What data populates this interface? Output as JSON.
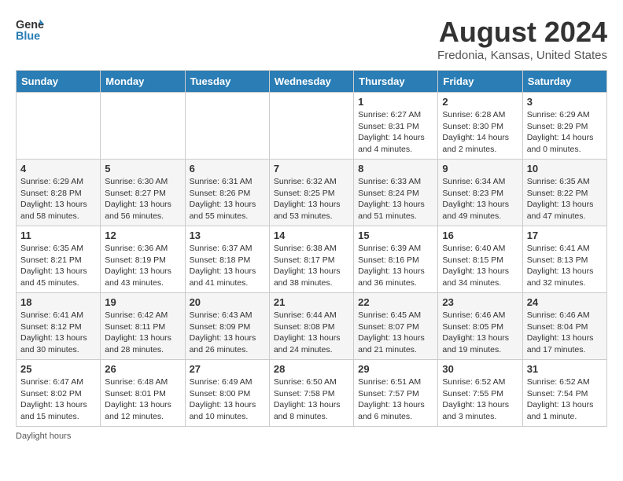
{
  "header": {
    "logo_line1": "General",
    "logo_line2": "Blue",
    "month": "August 2024",
    "location": "Fredonia, Kansas, United States"
  },
  "days_of_week": [
    "Sunday",
    "Monday",
    "Tuesday",
    "Wednesday",
    "Thursday",
    "Friday",
    "Saturday"
  ],
  "footer": "Daylight hours",
  "weeks": [
    [
      {
        "day": "",
        "sunrise": "",
        "sunset": "",
        "daylight": ""
      },
      {
        "day": "",
        "sunrise": "",
        "sunset": "",
        "daylight": ""
      },
      {
        "day": "",
        "sunrise": "",
        "sunset": "",
        "daylight": ""
      },
      {
        "day": "",
        "sunrise": "",
        "sunset": "",
        "daylight": ""
      },
      {
        "day": "1",
        "sunrise": "Sunrise: 6:27 AM",
        "sunset": "Sunset: 8:31 PM",
        "daylight": "Daylight: 14 hours and 4 minutes."
      },
      {
        "day": "2",
        "sunrise": "Sunrise: 6:28 AM",
        "sunset": "Sunset: 8:30 PM",
        "daylight": "Daylight: 14 hours and 2 minutes."
      },
      {
        "day": "3",
        "sunrise": "Sunrise: 6:29 AM",
        "sunset": "Sunset: 8:29 PM",
        "daylight": "Daylight: 14 hours and 0 minutes."
      }
    ],
    [
      {
        "day": "4",
        "sunrise": "Sunrise: 6:29 AM",
        "sunset": "Sunset: 8:28 PM",
        "daylight": "Daylight: 13 hours and 58 minutes."
      },
      {
        "day": "5",
        "sunrise": "Sunrise: 6:30 AM",
        "sunset": "Sunset: 8:27 PM",
        "daylight": "Daylight: 13 hours and 56 minutes."
      },
      {
        "day": "6",
        "sunrise": "Sunrise: 6:31 AM",
        "sunset": "Sunset: 8:26 PM",
        "daylight": "Daylight: 13 hours and 55 minutes."
      },
      {
        "day": "7",
        "sunrise": "Sunrise: 6:32 AM",
        "sunset": "Sunset: 8:25 PM",
        "daylight": "Daylight: 13 hours and 53 minutes."
      },
      {
        "day": "8",
        "sunrise": "Sunrise: 6:33 AM",
        "sunset": "Sunset: 8:24 PM",
        "daylight": "Daylight: 13 hours and 51 minutes."
      },
      {
        "day": "9",
        "sunrise": "Sunrise: 6:34 AM",
        "sunset": "Sunset: 8:23 PM",
        "daylight": "Daylight: 13 hours and 49 minutes."
      },
      {
        "day": "10",
        "sunrise": "Sunrise: 6:35 AM",
        "sunset": "Sunset: 8:22 PM",
        "daylight": "Daylight: 13 hours and 47 minutes."
      }
    ],
    [
      {
        "day": "11",
        "sunrise": "Sunrise: 6:35 AM",
        "sunset": "Sunset: 8:21 PM",
        "daylight": "Daylight: 13 hours and 45 minutes."
      },
      {
        "day": "12",
        "sunrise": "Sunrise: 6:36 AM",
        "sunset": "Sunset: 8:19 PM",
        "daylight": "Daylight: 13 hours and 43 minutes."
      },
      {
        "day": "13",
        "sunrise": "Sunrise: 6:37 AM",
        "sunset": "Sunset: 8:18 PM",
        "daylight": "Daylight: 13 hours and 41 minutes."
      },
      {
        "day": "14",
        "sunrise": "Sunrise: 6:38 AM",
        "sunset": "Sunset: 8:17 PM",
        "daylight": "Daylight: 13 hours and 38 minutes."
      },
      {
        "day": "15",
        "sunrise": "Sunrise: 6:39 AM",
        "sunset": "Sunset: 8:16 PM",
        "daylight": "Daylight: 13 hours and 36 minutes."
      },
      {
        "day": "16",
        "sunrise": "Sunrise: 6:40 AM",
        "sunset": "Sunset: 8:15 PM",
        "daylight": "Daylight: 13 hours and 34 minutes."
      },
      {
        "day": "17",
        "sunrise": "Sunrise: 6:41 AM",
        "sunset": "Sunset: 8:13 PM",
        "daylight": "Daylight: 13 hours and 32 minutes."
      }
    ],
    [
      {
        "day": "18",
        "sunrise": "Sunrise: 6:41 AM",
        "sunset": "Sunset: 8:12 PM",
        "daylight": "Daylight: 13 hours and 30 minutes."
      },
      {
        "day": "19",
        "sunrise": "Sunrise: 6:42 AM",
        "sunset": "Sunset: 8:11 PM",
        "daylight": "Daylight: 13 hours and 28 minutes."
      },
      {
        "day": "20",
        "sunrise": "Sunrise: 6:43 AM",
        "sunset": "Sunset: 8:09 PM",
        "daylight": "Daylight: 13 hours and 26 minutes."
      },
      {
        "day": "21",
        "sunrise": "Sunrise: 6:44 AM",
        "sunset": "Sunset: 8:08 PM",
        "daylight": "Daylight: 13 hours and 24 minutes."
      },
      {
        "day": "22",
        "sunrise": "Sunrise: 6:45 AM",
        "sunset": "Sunset: 8:07 PM",
        "daylight": "Daylight: 13 hours and 21 minutes."
      },
      {
        "day": "23",
        "sunrise": "Sunrise: 6:46 AM",
        "sunset": "Sunset: 8:05 PM",
        "daylight": "Daylight: 13 hours and 19 minutes."
      },
      {
        "day": "24",
        "sunrise": "Sunrise: 6:46 AM",
        "sunset": "Sunset: 8:04 PM",
        "daylight": "Daylight: 13 hours and 17 minutes."
      }
    ],
    [
      {
        "day": "25",
        "sunrise": "Sunrise: 6:47 AM",
        "sunset": "Sunset: 8:02 PM",
        "daylight": "Daylight: 13 hours and 15 minutes."
      },
      {
        "day": "26",
        "sunrise": "Sunrise: 6:48 AM",
        "sunset": "Sunset: 8:01 PM",
        "daylight": "Daylight: 13 hours and 12 minutes."
      },
      {
        "day": "27",
        "sunrise": "Sunrise: 6:49 AM",
        "sunset": "Sunset: 8:00 PM",
        "daylight": "Daylight: 13 hours and 10 minutes."
      },
      {
        "day": "28",
        "sunrise": "Sunrise: 6:50 AM",
        "sunset": "Sunset: 7:58 PM",
        "daylight": "Daylight: 13 hours and 8 minutes."
      },
      {
        "day": "29",
        "sunrise": "Sunrise: 6:51 AM",
        "sunset": "Sunset: 7:57 PM",
        "daylight": "Daylight: 13 hours and 6 minutes."
      },
      {
        "day": "30",
        "sunrise": "Sunrise: 6:52 AM",
        "sunset": "Sunset: 7:55 PM",
        "daylight": "Daylight: 13 hours and 3 minutes."
      },
      {
        "day": "31",
        "sunrise": "Sunrise: 6:52 AM",
        "sunset": "Sunset: 7:54 PM",
        "daylight": "Daylight: 13 hours and 1 minute."
      }
    ]
  ]
}
